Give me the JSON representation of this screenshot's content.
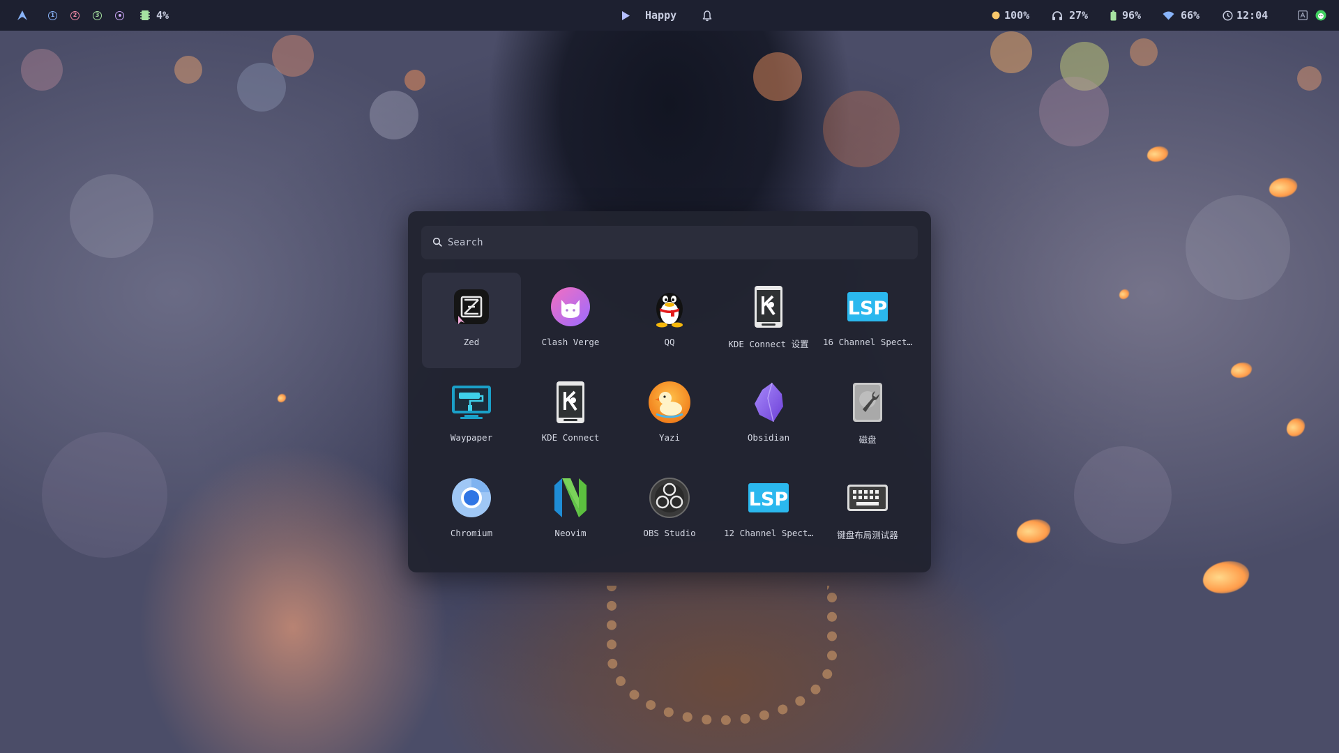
{
  "topbar": {
    "workspaces": [
      {
        "label": "1",
        "color": "#89b4fa"
      },
      {
        "label": "2",
        "color": "#f38ba8"
      },
      {
        "label": "3",
        "color": "#a6e3a1"
      },
      {
        "label": "4",
        "color": "#cba6f7"
      }
    ],
    "cpu_usage": "4%",
    "media_title": "Happy",
    "volume": "100%",
    "headphones": "27%",
    "battery": "96%",
    "wifi": "66%",
    "clock": "12:04",
    "colors": {
      "arch": "#89b4fa",
      "cpu": "#a6e3a1",
      "media_play": "#b4befe",
      "volume_dot": "#f9c86b",
      "battery": "#a6e3a1",
      "wifi": "#89b4fa",
      "tray_green": "#40d060"
    },
    "icons": [
      "arch-logo-icon",
      "cpu-icon",
      "play-icon",
      "bell-icon",
      "volume-icon",
      "headphones-icon",
      "battery-icon",
      "wifi-icon",
      "clock-icon",
      "keyboard-layout-icon",
      "tray-app-icon"
    ]
  },
  "launcher": {
    "search": {
      "placeholder": "Search",
      "value": ""
    },
    "apps": [
      {
        "label": "Zed",
        "icon": "zed-icon",
        "selected": true
      },
      {
        "label": "Clash Verge",
        "icon": "clash-verge-icon"
      },
      {
        "label": "QQ",
        "icon": "qq-icon"
      },
      {
        "label": "KDE Connect 设置",
        "icon": "kde-connect-settings-icon"
      },
      {
        "label": "16 Channel Spect…",
        "icon": "lsp-icon"
      },
      {
        "label": "Waypaper",
        "icon": "waypaper-icon"
      },
      {
        "label": "KDE Connect",
        "icon": "kde-connect-icon"
      },
      {
        "label": "Yazi",
        "icon": "yazi-icon"
      },
      {
        "label": "Obsidian",
        "icon": "obsidian-icon"
      },
      {
        "label": "磁盘",
        "icon": "disks-icon"
      },
      {
        "label": "Chromium",
        "icon": "chromium-icon"
      },
      {
        "label": "Neovim",
        "icon": "neovim-icon"
      },
      {
        "label": "OBS Studio",
        "icon": "obs-studio-icon"
      },
      {
        "label": "12 Channel Spect…",
        "icon": "lsp-icon"
      },
      {
        "label": "键盘布局测试器",
        "icon": "keyboard-icon"
      }
    ]
  }
}
